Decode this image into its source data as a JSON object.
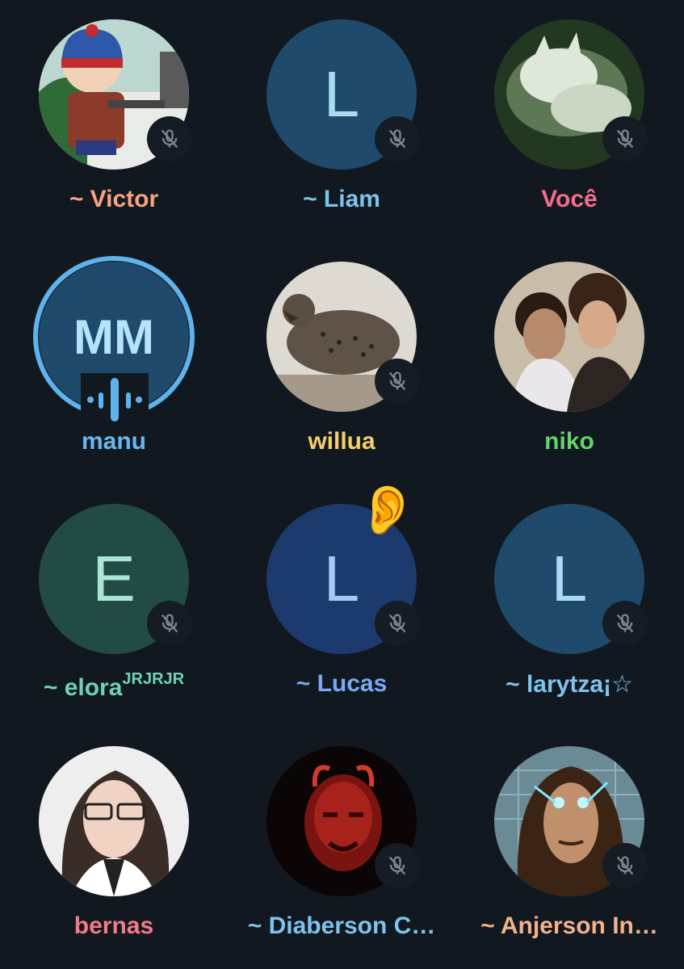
{
  "participants": [
    {
      "name": "~ Victor",
      "avatar_type": "photo",
      "photo_desc": "cartoon-boy",
      "name_color": "#f7a47c",
      "muted": true
    },
    {
      "name": "~ Liam",
      "avatar_type": "letter",
      "initial": "L",
      "bg": "#1f4a6b",
      "name_color": "#7ec3ee",
      "muted": true
    },
    {
      "name": "Você",
      "avatar_type": "photo",
      "photo_desc": "cat",
      "name_color": "#f46c8e",
      "muted": true
    },
    {
      "name": "manu",
      "avatar_type": "letter",
      "initial": "MM",
      "bg": "#1f4a6b",
      "name_color": "#6ab7ee",
      "muted": false,
      "speaking": true
    },
    {
      "name": "willua",
      "avatar_type": "photo",
      "photo_desc": "quail",
      "name_color": "#f2cf6a",
      "muted": true
    },
    {
      "name": "niko",
      "avatar_type": "photo",
      "photo_desc": "two-people",
      "name_color": "#66d26a",
      "muted": false
    },
    {
      "name": "~ elora",
      "name_sup": "JRJRJR",
      "avatar_type": "letter",
      "initial": "E",
      "bg": "#234b45",
      "name_color": "#6fd2b8",
      "muted": true
    },
    {
      "name": "~ Lucas",
      "avatar_type": "letter",
      "initial": "L",
      "bg": "#1d3a6e",
      "name_color": "#79a9f3",
      "muted": true,
      "emoji": "👂"
    },
    {
      "name": "~ larytza¡☆",
      "avatar_type": "letter",
      "initial": "L",
      "bg": "#1f4a6b",
      "name_color": "#7ec3ee",
      "muted": true
    },
    {
      "name": "bernas",
      "avatar_type": "photo",
      "photo_desc": "woman-glasses",
      "name_color": "#f27a8a",
      "muted": false
    },
    {
      "name": "~ Diaberson C…",
      "avatar_type": "photo",
      "photo_desc": "red-face",
      "name_color": "#7ec3ee",
      "muted": true
    },
    {
      "name": "~ Anjerson In…",
      "avatar_type": "photo",
      "photo_desc": "curly-hair",
      "name_color": "#f3b28a",
      "muted": true
    }
  ],
  "icons": {
    "mute": "mic-off-icon"
  }
}
